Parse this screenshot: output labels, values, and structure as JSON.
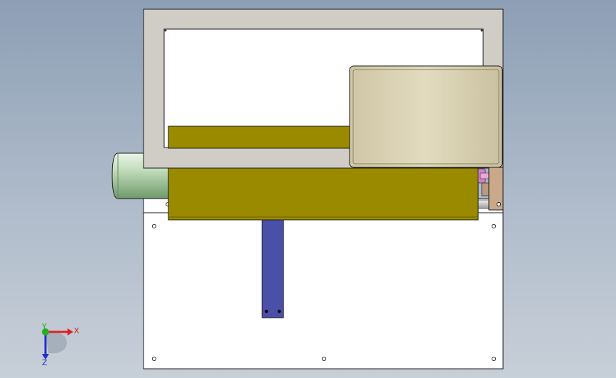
{
  "viewport": {
    "colors": {
      "background_top": "#8d9fb5",
      "background_bottom": "#c7cfd8",
      "base_plate": "#ffffff",
      "frame": "#cfcdc5",
      "frame_window": "#ffffff",
      "housing": "#dfd6b8",
      "rail": "#9a8a00",
      "motor": "#b5d4b0",
      "arm": "#4a4fa8",
      "bracket": "#c9a98a",
      "gear": "#d77fc4",
      "outline": "#1a1a1a"
    }
  },
  "triad": {
    "x_label": "X",
    "y_label": "Y",
    "z_label": "Z",
    "x_color": "#e02020",
    "y_color": "#20b020",
    "z_color": "#2030d0"
  }
}
